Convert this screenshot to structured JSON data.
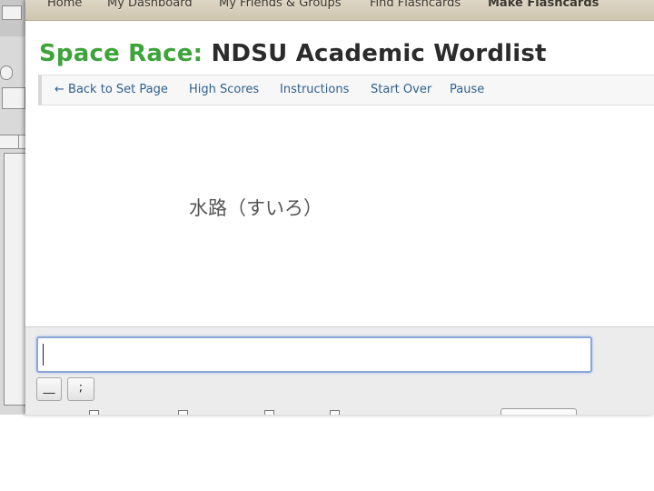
{
  "nav": {
    "items": [
      "Home",
      "My Dashboard",
      "My Friends & Groups",
      "Find Flashcards",
      "Make Flashcards"
    ]
  },
  "title": {
    "prefix": "Space Race:",
    "set_name": "NDSU Academic Wordlist"
  },
  "toolbar": {
    "back": "← Back to Set Page",
    "high_scores": "High Scores",
    "instructions": "Instructions",
    "start_over": "Start Over",
    "pause": "Pause"
  },
  "game": {
    "term": "水路（すいろ）"
  },
  "answer": {
    "value": "",
    "char_buttons": [
      "__",
      ";"
    ]
  },
  "colors": {
    "title_prefix": "#3da33a",
    "link": "#2e5f8e"
  }
}
